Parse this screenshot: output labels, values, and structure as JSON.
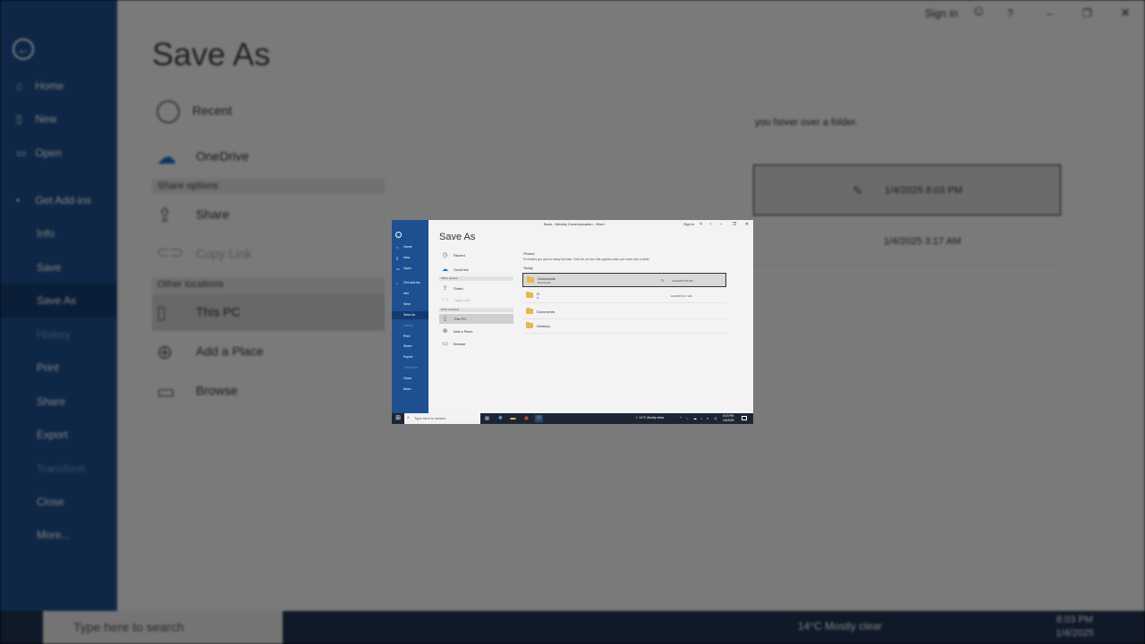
{
  "window": {
    "title": "Book - Weekly Communication - Word",
    "sign_in": "Sign in",
    "help": "?",
    "minimize": "–",
    "restore": "❐",
    "close": "✕",
    "coauthor_icon": "person-icon"
  },
  "sidebar": {
    "back": "←",
    "items": [
      {
        "label": "Home",
        "icon": "home-icon",
        "glyph": "⌂"
      },
      {
        "label": "New",
        "icon": "new-doc-icon",
        "glyph": "▯"
      },
      {
        "label": "Open",
        "icon": "open-folder-icon",
        "glyph": "▭"
      },
      {
        "label": "Get Add-ins",
        "icon": "add-ins-icon",
        "glyph": "•"
      },
      {
        "label": "Info"
      },
      {
        "label": "Save"
      },
      {
        "label": "Save As"
      },
      {
        "label": "History"
      },
      {
        "label": "Print"
      },
      {
        "label": "Share"
      },
      {
        "label": "Export"
      },
      {
        "label": "Transform"
      },
      {
        "label": "Close"
      },
      {
        "label": "More..."
      }
    ]
  },
  "main": {
    "title": "Save As",
    "locations": {
      "recent": "Recent",
      "onedrive": "OneDrive",
      "share_options_header": "Share options",
      "share": "Share",
      "copy_link": "Copy Link",
      "other_locations_header": "Other locations",
      "this_pc": "This PC",
      "add_place": "Add a Place",
      "browse": "Browse"
    },
    "right": {
      "pinned_header": "Pinned",
      "pinned_hint": "Pin folders you want to easily find later. Click the pin icon that appears when you hover over a folder.",
      "today_header": "Today",
      "folders": [
        {
          "name": "Downloads",
          "path": "Downloads",
          "date": "1/4/2025 8:03 PM",
          "selected": true
        },
        {
          "name": "D:",
          "path": "D:",
          "date": "1/4/2025 3:17 AM",
          "selected": false
        },
        {
          "name": "Documents",
          "path": "",
          "date": "",
          "selected": false
        },
        {
          "name": "Desktop",
          "path": "",
          "date": "",
          "selected": false
        }
      ]
    }
  },
  "taskbar": {
    "search_placeholder": "Type here to search",
    "weather": "14°C  Mostly clear",
    "time": "8:03 PM",
    "date": "1/4/2025"
  },
  "colors": {
    "sidebar": "#1d4f91",
    "sidebar_selected": "#123a6e",
    "folder": "#e6b74c",
    "taskbar": "#1c2633"
  }
}
